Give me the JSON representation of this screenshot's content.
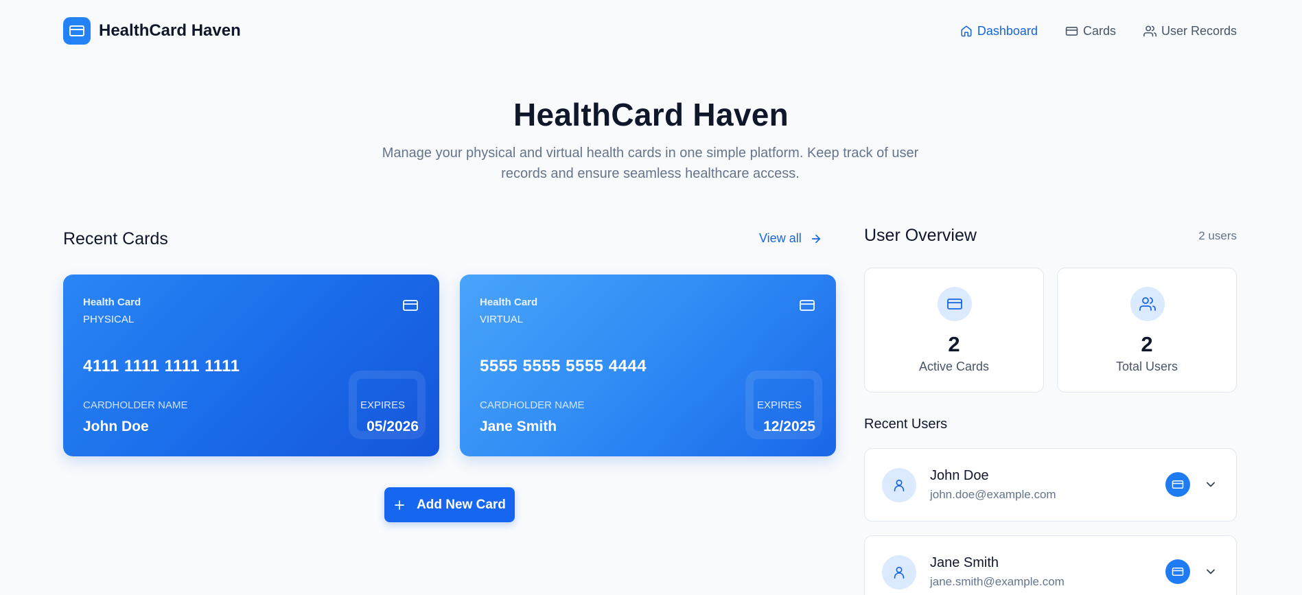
{
  "app": {
    "brand_name": "HealthCard Haven",
    "accent_color": "#1565e0",
    "brand_color": "#2382f5"
  },
  "nav": {
    "items": [
      {
        "label": "Dashboard",
        "icon": "home-icon",
        "active": true
      },
      {
        "label": "Cards",
        "icon": "credit-card-icon",
        "active": false
      },
      {
        "label": "User Records",
        "icon": "users-icon",
        "active": false
      }
    ]
  },
  "hero": {
    "title": "HealthCard Haven",
    "subtitle": "Manage your physical and virtual health cards in one simple platform. Keep track of user records and ensure seamless healthcare access."
  },
  "recent_cards": {
    "title": "Recent Cards",
    "view_all_label": "View all",
    "cards": [
      {
        "label": "Health Card",
        "type": "PHYSICAL",
        "number": "4111 1111 1111 1111",
        "cardholder_label": "CARDHOLDER NAME",
        "cardholder_name": "John Doe",
        "expires_label": "EXPIRES",
        "expires": "05/2026"
      },
      {
        "label": "Health Card",
        "type": "VIRTUAL",
        "number": "5555 5555 5555 4444",
        "cardholder_label": "CARDHOLDER NAME",
        "cardholder_name": "Jane Smith",
        "expires_label": "EXPIRES",
        "expires": "12/2025"
      }
    ],
    "add_button_label": "Add New Card"
  },
  "user_overview": {
    "title": "User Overview",
    "count_label": "2 users",
    "stats": [
      {
        "value": "2",
        "label": "Active Cards",
        "icon": "credit-card-icon"
      },
      {
        "value": "2",
        "label": "Total Users",
        "icon": "users-icon"
      }
    ],
    "recent_users_title": "Recent Users",
    "users": [
      {
        "name": "John Doe",
        "email": "john.doe@example.com"
      },
      {
        "name": "Jane Smith",
        "email": "jane.smith@example.com"
      }
    ]
  }
}
